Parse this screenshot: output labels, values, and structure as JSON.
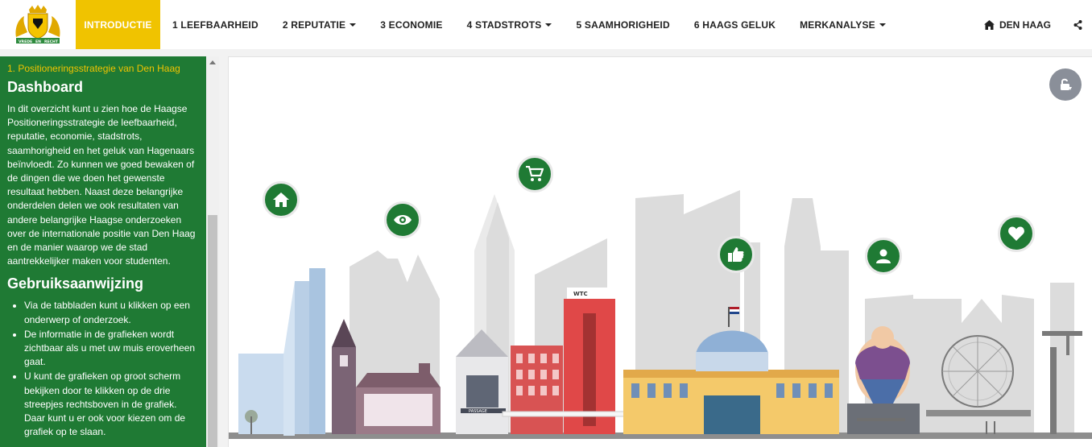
{
  "navbar": {
    "logo_alt": "Wapen van Den Haag",
    "logo_motto": [
      "VREDE",
      "EN",
      "RECHT"
    ],
    "tabs": [
      {
        "label": "INTRODUCTIE",
        "active": true,
        "dropdown": false
      },
      {
        "label": "1 LEEFBAARHEID",
        "active": false,
        "dropdown": false
      },
      {
        "label": "2 REPUTATIE",
        "active": false,
        "dropdown": true
      },
      {
        "label": "3 ECONOMIE",
        "active": false,
        "dropdown": false
      },
      {
        "label": "4 STADSTROTS",
        "active": false,
        "dropdown": true
      },
      {
        "label": "5 SAAMHORIGHEID",
        "active": false,
        "dropdown": false
      },
      {
        "label": "6 HAAGS GELUK",
        "active": false,
        "dropdown": false
      },
      {
        "label": "MERKANALYSE",
        "active": false,
        "dropdown": true
      }
    ],
    "home_label": "DEN HAAG",
    "home_icon": "home-icon",
    "share_icon": "share-icon"
  },
  "sidebar": {
    "breadcrumb": "1. Positioneringsstrategie van Den Haag",
    "title": "Dashboard",
    "intro": "In dit overzicht kunt u zien hoe de Haagse Positioneringsstrategie de leefbaarheid, reputatie, economie, stadstrots, saamhorigheid en het geluk van Hagenaars beïnvloedt. Zo kunnen we goed bewaken of de dingen die we doen het gewenste resultaat hebben. Naast deze belangrijke onderdelen delen we ook resultaten van andere belangrijke Haagse onderzoeken over de internationale positie van Den Haag en de manier waarop we de stad aantrekkelijker maken voor studenten.",
    "instructions_title": "Gebruiksaanwijzing",
    "instructions": [
      "Via de tabbladen kunt u klikken op een onderwerp of onderzoek.",
      "De informatie in de grafieken wordt zichtbaar als u met uw muis eroverheen gaat.",
      "U kunt de grafieken op groot scherm bekijken door te klikken op de drie streepjes rechtsboven in de grafiek. Daar kunt u er ook voor kiezen om de grafiek op te slaan."
    ]
  },
  "main": {
    "unlock_icon": "unlock-icon",
    "building_signs": [
      "WTC",
      "PASSAGE"
    ],
    "bubbles": [
      {
        "name": "leefbaarheid-bubble",
        "icon": "home-icon"
      },
      {
        "name": "reputatie-bubble",
        "icon": "eye-icon"
      },
      {
        "name": "economie-bubble",
        "icon": "shopping-cart-icon"
      },
      {
        "name": "stadstrots-bubble",
        "icon": "thumbs-up-icon"
      },
      {
        "name": "saamhorigheid-bubble",
        "icon": "user-icon"
      },
      {
        "name": "haags-geluk-bubble",
        "icon": "heart-icon"
      }
    ]
  },
  "colors": {
    "accent_yellow": "#f0c300",
    "sidebar_green": "#1f7a34",
    "bubble_green": "#1f7a34",
    "unlock_gray": "#8a8f99"
  }
}
